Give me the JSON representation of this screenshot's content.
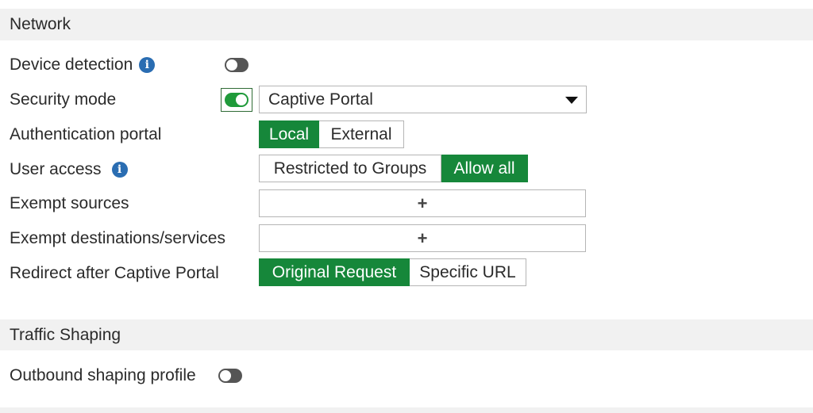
{
  "sections": {
    "network": {
      "title": "Network"
    },
    "traffic_shaping": {
      "title": "Traffic Shaping"
    }
  },
  "fields": {
    "device_detection": {
      "label": "Device detection",
      "info_icon": "info-icon",
      "enabled": false
    },
    "security_mode": {
      "label": "Security mode",
      "enabled": true,
      "selected": "Captive Portal"
    },
    "authentication_portal": {
      "label": "Authentication portal",
      "options": [
        "Local",
        "External"
      ],
      "selected": "Local"
    },
    "user_access": {
      "label": "User access",
      "info_icon": "info-icon",
      "options": [
        "Restricted to Groups",
        "Allow all"
      ],
      "selected": "Allow all"
    },
    "exempt_sources": {
      "label": "Exempt sources",
      "add_symbol": "+"
    },
    "exempt_destinations": {
      "label": "Exempt destinations/services",
      "add_symbol": "+"
    },
    "redirect_after_portal": {
      "label": "Redirect after Captive Portal",
      "options": [
        "Original Request",
        "Specific URL"
      ],
      "selected": "Original Request"
    },
    "outbound_shaping_profile": {
      "label": "Outbound shaping profile",
      "enabled": false
    }
  },
  "icons": {
    "info": "i"
  },
  "colors": {
    "active_green": "#16873a",
    "toggle_on": "#1f9a3a",
    "toggle_off": "#555555",
    "info_blue": "#2a6db2",
    "section_bg": "#f1f1f1"
  }
}
